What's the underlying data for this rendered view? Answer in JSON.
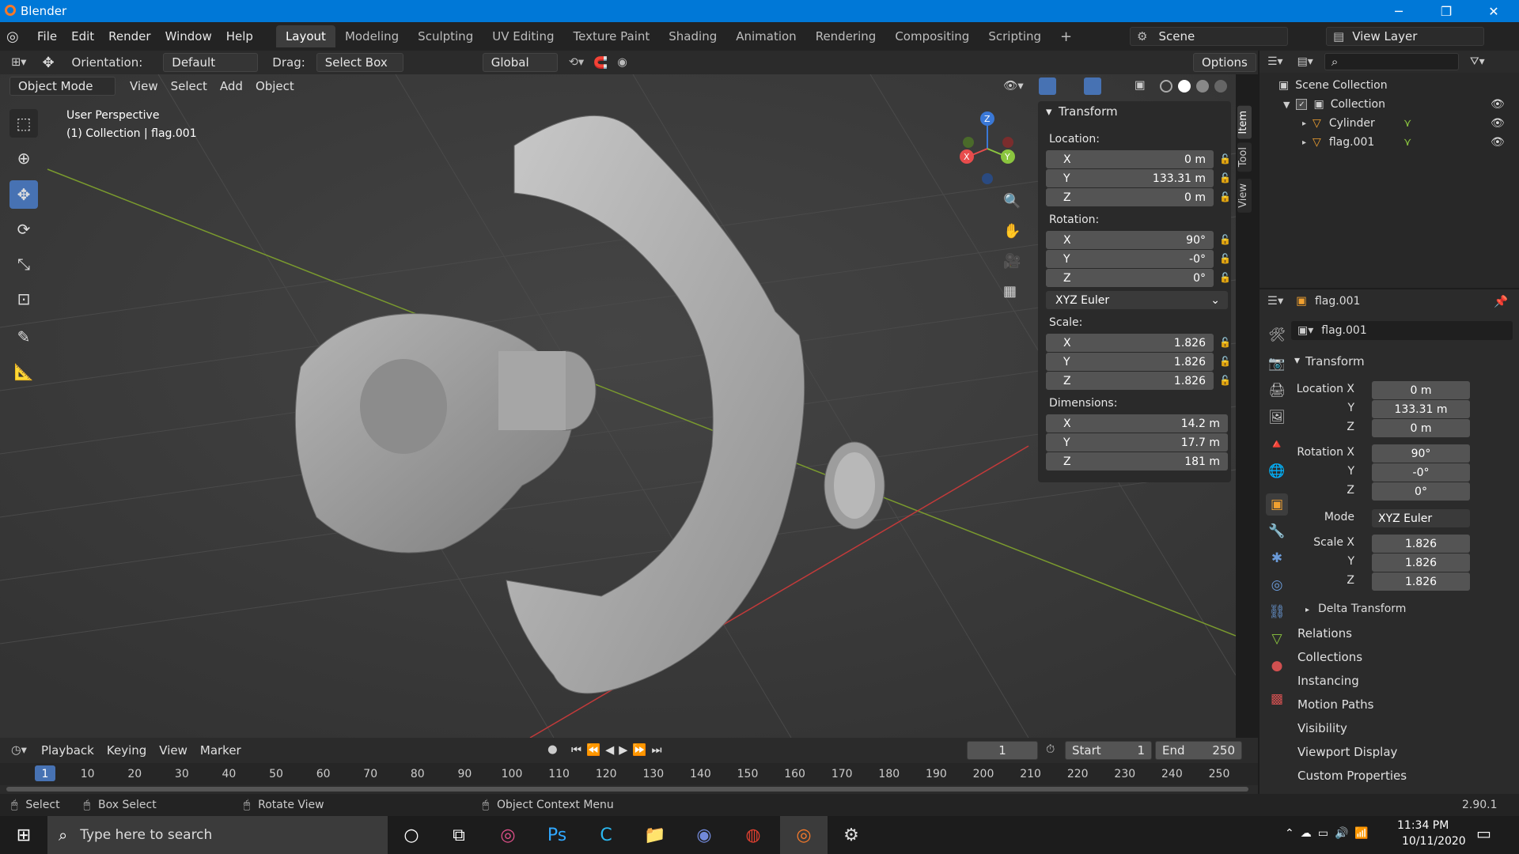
{
  "window": {
    "title": "Blender",
    "min": "─",
    "max": "❐",
    "close": "✕"
  },
  "menu": [
    "File",
    "Edit",
    "Render",
    "Window",
    "Help"
  ],
  "workspaces": [
    "Layout",
    "Modeling",
    "Sculpting",
    "UV Editing",
    "Texture Paint",
    "Shading",
    "Animation",
    "Rendering",
    "Compositing",
    "Scripting"
  ],
  "workspace_add": "+",
  "scene": {
    "name": "Scene",
    "view_layer": "View Layer"
  },
  "toolheader": {
    "orientation_label": "Orientation:",
    "orientation": "Default",
    "drag_label": "Drag:",
    "drag": "Select Box",
    "transform": "Global",
    "options": "Options"
  },
  "viewheader": {
    "mode": "Object Mode",
    "view": "View",
    "select": "Select",
    "add": "Add",
    "object": "Object"
  },
  "viewport": {
    "perspective": "User Perspective",
    "collection": "(1) Collection | flag.001"
  },
  "npanel": {
    "section": "Transform",
    "location": "Location:",
    "rotation": "Rotation:",
    "scale": "Scale:",
    "dimensions": "Dimensions:",
    "loc": [
      {
        "axis": "X",
        "val": "0 m"
      },
      {
        "axis": "Y",
        "val": "133.31 m"
      },
      {
        "axis": "Z",
        "val": "0 m"
      }
    ],
    "rot": [
      {
        "axis": "X",
        "val": "90°"
      },
      {
        "axis": "Y",
        "val": "-0°"
      },
      {
        "axis": "Z",
        "val": "0°"
      }
    ],
    "euler": "XYZ Euler",
    "scl": [
      {
        "axis": "X",
        "val": "1.826"
      },
      {
        "axis": "Y",
        "val": "1.826"
      },
      {
        "axis": "Z",
        "val": "1.826"
      }
    ],
    "dim": [
      {
        "axis": "X",
        "val": "14.2 m"
      },
      {
        "axis": "Y",
        "val": "17.7 m"
      },
      {
        "axis": "Z",
        "val": "181 m"
      }
    ],
    "tabs": [
      "Item",
      "Tool",
      "View"
    ]
  },
  "outliner": {
    "scene_collection": "Scene Collection",
    "collection": "Collection",
    "items": [
      "Cylinder",
      "flag.001"
    ]
  },
  "properties": {
    "object": "flag.001",
    "object_field": "flag.001",
    "section": "Transform",
    "location_label": "Location X",
    "rotation_label": "Rotation X",
    "mode_label": "Mode",
    "scale_label": "Scale X",
    "axis_y": "Y",
    "axis_z": "Z",
    "loc": [
      "0 m",
      "133.31 m",
      "0 m"
    ],
    "rot": [
      "90°",
      "-0°",
      "0°"
    ],
    "mode": "XYZ Euler",
    "scl": [
      "1.826",
      "1.826",
      "1.826"
    ],
    "delta": "Delta Transform",
    "panels": [
      "Relations",
      "Collections",
      "Instancing",
      "Motion Paths",
      "Visibility",
      "Viewport Display",
      "Custom Properties"
    ]
  },
  "timeline": {
    "playback": "Playback",
    "keying": "Keying",
    "view": "View",
    "marker": "Marker",
    "frame": "1",
    "start_label": "Start",
    "start": "1",
    "end_label": "End",
    "end": "250",
    "ticks": [
      "1",
      "10",
      "20",
      "30",
      "40",
      "50",
      "60",
      "70",
      "80",
      "90",
      "100",
      "110",
      "120",
      "130",
      "140",
      "150",
      "160",
      "170",
      "180",
      "190",
      "200",
      "210",
      "220",
      "230",
      "240",
      "250"
    ]
  },
  "status": {
    "select": "Select",
    "box": "Box Select",
    "rotate": "Rotate View",
    "context": "Object Context Menu",
    "version": "2.90.1"
  },
  "taskbar": {
    "search": "Type here to search",
    "time": "11:34 PM",
    "date": "10/11/2020"
  },
  "gizmo": {
    "x": "X",
    "y": "Y",
    "z": "Z"
  },
  "colors": {
    "accent": "#4772b3",
    "titlebar": "#0078d7",
    "x_axis": "#e84c4c",
    "y_axis": "#8bc53f",
    "z_axis": "#3a78d6"
  }
}
